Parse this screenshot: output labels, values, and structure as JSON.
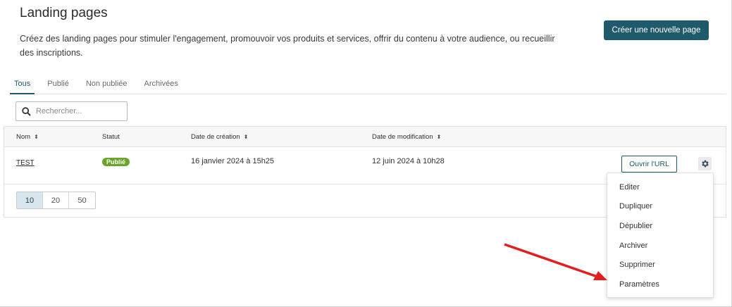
{
  "header": {
    "title": "Landing pages",
    "description": "Créez des landing pages pour stimuler l'engagement, promouvoir vos produits et services, offrir du contenu à votre audience, ou recueillir des inscriptions.",
    "create_button": "Créer une nouvelle page"
  },
  "tabs": [
    {
      "label": "Tous",
      "active": true
    },
    {
      "label": "Publié",
      "active": false
    },
    {
      "label": "Non publiée",
      "active": false
    },
    {
      "label": "Archivées",
      "active": false
    }
  ],
  "search": {
    "placeholder": "Rechercher...",
    "value": ""
  },
  "table": {
    "columns": [
      "Nom",
      "Statut",
      "Date de création",
      "Date de modification"
    ],
    "rows": [
      {
        "name": "TEST",
        "status": "Publié",
        "created": "16 janvier 2024 à 15h25",
        "modified": "12 juin 2024 à 10h28",
        "action": "Ouvrir l'URL"
      }
    ]
  },
  "pagination": {
    "sizes": [
      "10",
      "20",
      "50"
    ],
    "selected": "10"
  },
  "context_menu": {
    "items": [
      "Editer",
      "Dupliquer",
      "Dépublier",
      "Archiver",
      "Supprimer",
      "Paramètres"
    ]
  },
  "colors": {
    "accent": "#1f5a6b",
    "badge": "#6aa428",
    "arrow": "#e02020"
  },
  "icons": {
    "search": "search-icon",
    "gear": "gear-icon",
    "sort": "sort-icon"
  }
}
